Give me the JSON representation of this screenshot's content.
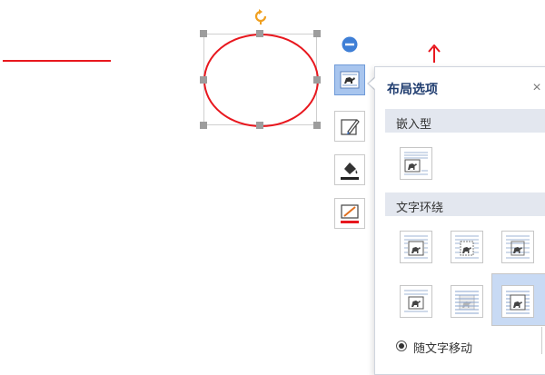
{
  "canvas": {
    "shape_color": "#e8171e"
  },
  "panel": {
    "title": "布局选项",
    "close_glyph": "×",
    "sections": {
      "inline": {
        "label": "嵌入型"
      },
      "wrap": {
        "label": "文字环绕"
      }
    },
    "move_with_text_label": "随文字移动",
    "move_with_text_checked": true
  },
  "toolbar": {
    "icons": [
      "collapse-icon",
      "layout-options-icon",
      "shape-style-icon",
      "fill-color-icon",
      "outline-color-icon"
    ],
    "active": "layout-options-icon"
  },
  "colors": {
    "accent": "#a8c5ee",
    "panel_title": "#1f3c6f",
    "section_bg": "#e3e7ef",
    "selected_option": "#c8daf4",
    "rotate_handle": "#f0a020"
  }
}
